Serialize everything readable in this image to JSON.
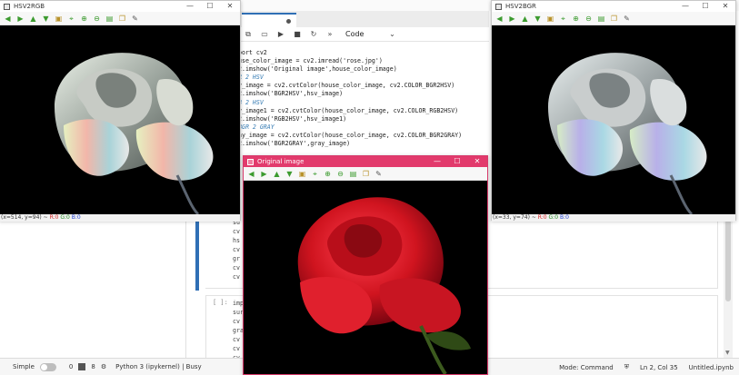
{
  "windows": {
    "hsv2rgb": {
      "title": "HSV2RGB",
      "status": {
        "coords": "(x=514, y=94) ~",
        "r": "R:0",
        "g": "G:0",
        "b": "B:0"
      }
    },
    "hsv2bgr": {
      "title": "HSV2BGR",
      "status": {
        "coords": "(x=33, y=74) ~",
        "r": "R:0",
        "g": "G:0",
        "b": "B:0"
      }
    },
    "original": {
      "title": "Original image"
    },
    "controls": {
      "minimize": "—",
      "maximize": "☐",
      "close": "✕"
    }
  },
  "toolbar_icons": [
    "arrow-left",
    "arrow-right",
    "arrow-up",
    "arrow-down",
    "panning",
    "zoom-in",
    "zoom-in-2",
    "zoom-out",
    "save",
    "copy",
    "properties"
  ],
  "notebook": {
    "cell_type": "Code",
    "code_lines": [
      "port cv2",
      "use_color_image = cv2.imread('rose.jpg')",
      "2.imshow('Original image',house_color_image)",
      "R 2 HSV",
      "v_image = cv2.cvtColor(house_color_image, cv2.COLOR_BGR2HSV)",
      "2.imshow('BGR2HSV',hsv_image)",
      "B 2 HSV",
      "v_image1 = cv2.cvtColor(house_color_image, cv2.COLOR_RGB2HSV)",
      "2.imshow('RGB2HSV',hsv_image1)",
      "BGR 2 GRAY",
      "ay_image = cv2.cvtColor(house_color_image, cv2.COLOR_BGR2GRAY)",
      "2.imshow('BGR2GRAY',gray_image)"
    ],
    "cell1_rest": "su\ncv\nhs\ncv\ngr\ncv\ncv",
    "cell2_prompt": "[ ]:",
    "cell2_lines": "imp\nsur\ncv\ngra\ncv\ncv\ncv"
  },
  "statusbar": {
    "mode_label": "Simple",
    "count1": "0",
    "count2": "8",
    "kernel": "Python 3 (ipykernel) | Busy",
    "mode": "Mode: Command",
    "position": "Ln 2, Col 35",
    "filename": "Untitled.ipynb"
  }
}
